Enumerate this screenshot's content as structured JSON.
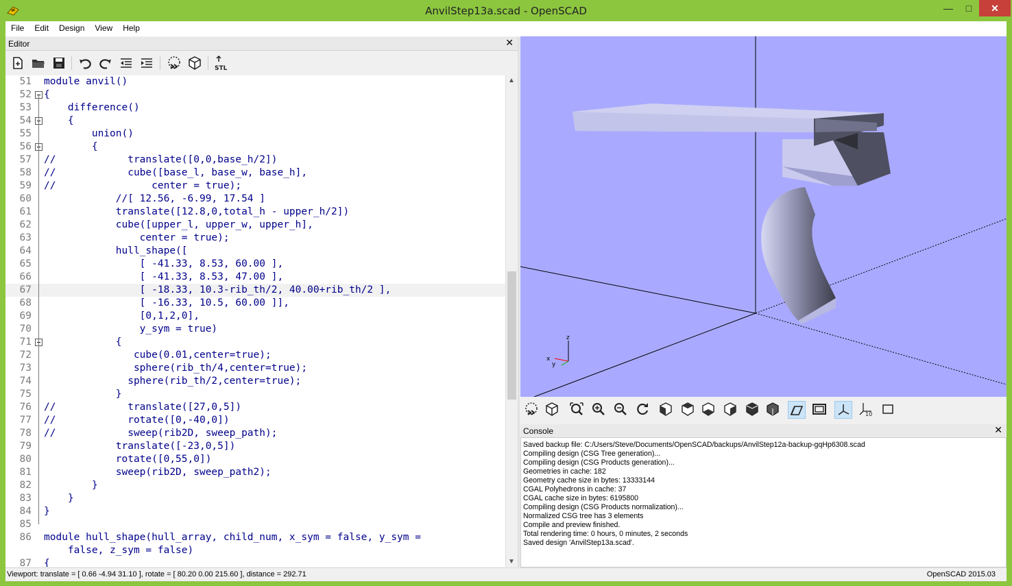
{
  "window": {
    "title": "AnvilStep13a.scad - OpenSCAD"
  },
  "menu": [
    "File",
    "Edit",
    "Design",
    "View",
    "Help"
  ],
  "editor": {
    "label": "Editor",
    "lines": [
      {
        "n": "51",
        "text": "module anvil()",
        "kind": "kw",
        "indent": 0
      },
      {
        "n": "52",
        "text": "{",
        "kind": "kw",
        "indent": 0,
        "fold": true
      },
      {
        "n": "53",
        "text": "    difference()",
        "kind": "kw",
        "indent": 0
      },
      {
        "n": "54",
        "text": "    {",
        "kind": "kw",
        "indent": 0,
        "fold": true
      },
      {
        "n": "55",
        "text": "        union()",
        "kind": "kw",
        "indent": 0
      },
      {
        "n": "56",
        "text": "        {",
        "kind": "kw",
        "indent": 0,
        "fold": true
      },
      {
        "n": "57",
        "text": "//            translate([0,0,base_h/2])",
        "kind": "kw",
        "indent": 0
      },
      {
        "n": "58",
        "text": "//            cube([base_l, base_w, base_h],",
        "kind": "kw",
        "indent": 0
      },
      {
        "n": "59",
        "text": "//                center = true);",
        "kind": "kw",
        "indent": 0
      },
      {
        "n": "60",
        "text": "            //[ 12.56, -6.99, 17.54 ]",
        "kind": "kw",
        "indent": 0
      },
      {
        "n": "61",
        "text": "            translate([12.8,0,total_h - upper_h/2])",
        "kind": "kw",
        "indent": 0
      },
      {
        "n": "62",
        "text": "            cube([upper_l, upper_w, upper_h],",
        "kind": "kw",
        "indent": 0
      },
      {
        "n": "63",
        "text": "                center = true);",
        "kind": "kw",
        "indent": 0
      },
      {
        "n": "64",
        "text": "            hull_shape([",
        "kind": "kw",
        "indent": 0
      },
      {
        "n": "65",
        "text": "                [ -41.33, 8.53, 60.00 ],",
        "kind": "kw",
        "indent": 0
      },
      {
        "n": "66",
        "text": "                [ -41.33, 8.53, 47.00 ],",
        "kind": "kw",
        "indent": 0
      },
      {
        "n": "67",
        "text": "                [ -18.33, 10.3-rib_th/2, 40.00+rib_th/2 ],",
        "kind": "kw",
        "indent": 0,
        "current": true
      },
      {
        "n": "68",
        "text": "                [ -16.33, 10.5, 60.00 ]],",
        "kind": "kw",
        "indent": 0
      },
      {
        "n": "69",
        "text": "                [0,1,2,0],",
        "kind": "kw",
        "indent": 0
      },
      {
        "n": "70",
        "text": "                y_sym = true)",
        "kind": "kw",
        "indent": 0
      },
      {
        "n": "71",
        "text": "            {",
        "kind": "kw",
        "indent": 0,
        "fold": true
      },
      {
        "n": "72",
        "text": "               cube(0.01,center=true);",
        "kind": "kw",
        "indent": 0
      },
      {
        "n": "73",
        "text": "               sphere(rib_th/4,center=true);",
        "kind": "kw",
        "indent": 0
      },
      {
        "n": "74",
        "text": "              sphere(rib_th/2,center=true);",
        "kind": "kw",
        "indent": 0
      },
      {
        "n": "75",
        "text": "            }",
        "kind": "kw",
        "indent": 0
      },
      {
        "n": "76",
        "text": "//            translate([27,0,5])",
        "kind": "kw",
        "indent": 0
      },
      {
        "n": "77",
        "text": "//            rotate([0,-40,0])",
        "kind": "kw",
        "indent": 0
      },
      {
        "n": "78",
        "text": "//            sweep(rib2D, sweep_path);",
        "kind": "kw",
        "indent": 0
      },
      {
        "n": "79",
        "text": "            translate([-23,0,5])",
        "kind": "kw",
        "indent": 0
      },
      {
        "n": "80",
        "text": "            rotate([0,55,0])",
        "kind": "kw",
        "indent": 0
      },
      {
        "n": "81",
        "text": "            sweep(rib2D, sweep_path2);",
        "kind": "kw",
        "indent": 0
      },
      {
        "n": "82",
        "text": "        }",
        "kind": "kw",
        "indent": 0
      },
      {
        "n": "83",
        "text": "    }",
        "kind": "kw",
        "indent": 0
      },
      {
        "n": "84",
        "text": "}",
        "kind": "kw",
        "indent": 0
      },
      {
        "n": "85",
        "text": "",
        "kind": "kw",
        "indent": 0
      },
      {
        "n": "86",
        "text": "module hull_shape(hull_array, child_num, x_sym = false, y_sym =",
        "kind": "kw",
        "indent": 0
      },
      {
        "n": "",
        "text": "    false, z_sym = false)",
        "kind": "kw",
        "indent": 0
      },
      {
        "n": "87",
        "text": "{",
        "kind": "kw",
        "indent": 0
      }
    ]
  },
  "console": {
    "label": "Console",
    "lines": [
      "Saved backup file: C:/Users/Steve/Documents/OpenSCAD/backups/AnvilStep12a-backup-gqHp6308.scad",
      "Compiling design (CSG Tree generation)...",
      "Compiling design (CSG Products generation)...",
      "Geometries in cache: 182",
      "Geometry cache size in bytes: 13333144",
      "CGAL Polyhedrons in cache: 37",
      "CGAL cache size in bytes: 6195800",
      "Compiling design (CSG Products normalization)...",
      "Normalized CSG tree has 3 elements",
      "Compile and preview finished.",
      "Total rendering time: 0 hours, 0 minutes, 2 seconds",
      "Saved design 'AnvilStep13a.scad'."
    ]
  },
  "statusbar": {
    "viewport": "Viewport: translate = [ 0.66 -4.94 31.10 ], rotate = [ 80.20 0.00 215.60 ], distance = 292.71",
    "version": "OpenSCAD 2015.03"
  },
  "axes": {
    "x": "x",
    "y": "y",
    "z": "z"
  },
  "colors": {
    "viewport_bg": "#a9aaff",
    "keyword": "#00008b",
    "titlebar": "#8cc63f",
    "close": "#c7403a"
  }
}
